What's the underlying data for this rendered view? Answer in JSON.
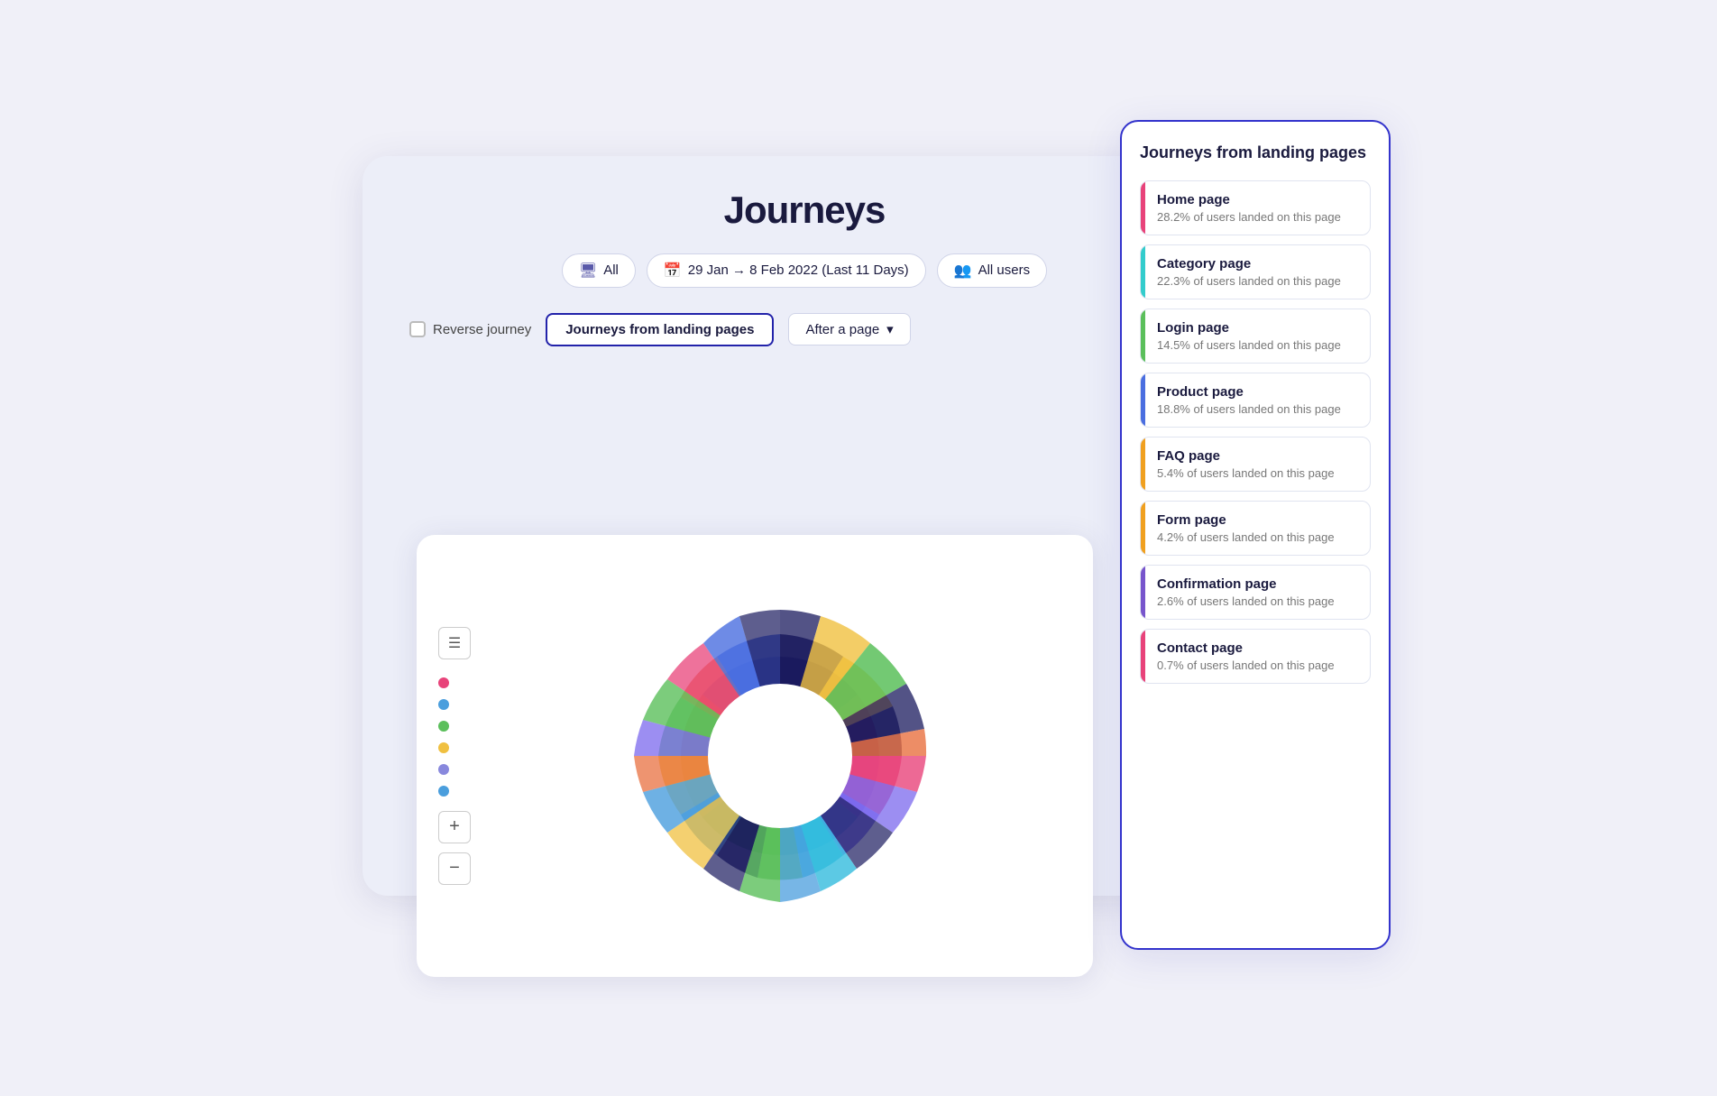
{
  "title": "Journeys",
  "toolbar": {
    "all_label": "All",
    "date_label": "29 Jan → 8 Feb 2022 (Last 11 Days)",
    "users_label": "All users"
  },
  "subtoolbar": {
    "reverse_label": "Reverse journey",
    "active_tab": "Journeys from landing pages",
    "dropdown_label": "After a page"
  },
  "legend_dots": [
    {
      "color": "#e8437a"
    },
    {
      "color": "#4a9edd"
    },
    {
      "color": "#5bbf5b"
    },
    {
      "color": "#f0c040"
    },
    {
      "color": "#8888dd"
    },
    {
      "color": "#4a9edd"
    }
  ],
  "right_panel": {
    "title": "Journeys from landing pages",
    "items": [
      {
        "name": "Home page",
        "stat": "28.2% of users landed on this page",
        "color": "#e8437a"
      },
      {
        "name": "Category page",
        "stat": "22.3% of users landed on this page",
        "color": "#33cccc"
      },
      {
        "name": "Login page",
        "stat": "14.5% of users landed on this page",
        "color": "#5bbf5b"
      },
      {
        "name": "Product page",
        "stat": "18.8% of users landed on this page",
        "color": "#4a6ee0"
      },
      {
        "name": "FAQ page",
        "stat": "5.4% of users landed on this page",
        "color": "#f0a020"
      },
      {
        "name": "Form page",
        "stat": "4.2% of users landed on this page",
        "color": "#f0a020"
      },
      {
        "name": "Confirmation page",
        "stat": "2.6% of users landed on this page",
        "color": "#7755cc"
      },
      {
        "name": "Contact page",
        "stat": "0.7% of users landed on this page",
        "color": "#e8437a"
      }
    ]
  },
  "zoom_plus": "+",
  "zoom_minus": "−",
  "list_icon": "☰"
}
